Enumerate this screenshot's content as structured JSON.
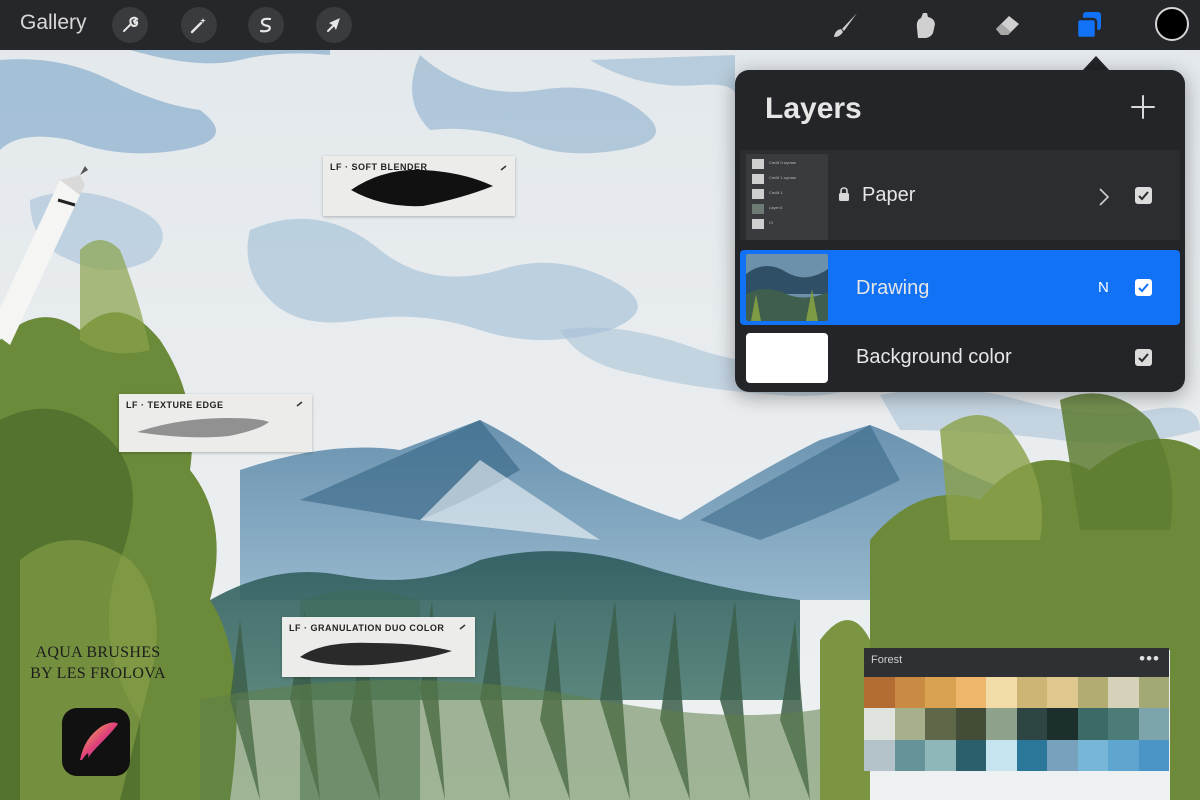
{
  "toolbar": {
    "gallery_label": "Gallery",
    "left_tools": [
      "wrench-icon",
      "magic-wand-icon",
      "selection-icon",
      "transform-arrow-icon"
    ],
    "right_tools": [
      "brush-icon",
      "smudge-icon",
      "eraser-icon",
      "layers-icon"
    ],
    "active_tool": "layers-icon",
    "current_color": "#000000"
  },
  "layers_panel": {
    "title": "Layers",
    "add_symbol": "+",
    "rows": [
      {
        "name": "Paper",
        "locked": true,
        "group": true,
        "visible": true
      },
      {
        "name": "Drawing",
        "blend_mode": "N",
        "selected": true,
        "visible": true
      },
      {
        "name": "Background color",
        "visible": true
      }
    ],
    "paper_group_layers": [
      "Cmöll 0 ыуннм",
      "Cmöll 1 ыуннм",
      "Cmöll 1",
      "Layer 6",
      "СІ"
    ]
  },
  "brushes": [
    {
      "label": "LF · SOFT BLENDER"
    },
    {
      "label": "LF · TEXTURE EDGE"
    },
    {
      "label": "LF · GRANULATION DUO COLOR"
    }
  ],
  "watermark": {
    "line1": "AQUA BRUSHES",
    "line2": "BY LES FROLOVA"
  },
  "palette": {
    "name": "Forest",
    "menu_symbol": "•••",
    "rows": [
      [
        "#b36c32",
        "#c98a44",
        "#d9a250",
        "#edb66a",
        "#f1dca8",
        "#cdb576",
        "#dfc88e",
        "#b3ac72",
        "#d6d2ba",
        "#a3a874"
      ],
      [
        "#dfe3dd",
        "#a6b08d",
        "#5e6849",
        "#424c36",
        "#8ea28b",
        "#2d4644",
        "#1d2f2c",
        "#3c6a66",
        "#4d7b78",
        "#7da4ab"
      ],
      [
        "#b4c3c9",
        "#649399",
        "#8fb7ba",
        "#2b5f6c",
        "#c6e4ef",
        "#2a779a",
        "#77a1bc",
        "#78b6d7",
        "#5ea6cf",
        "#4b95c6"
      ]
    ]
  },
  "colors": {
    "toolbar": "#26272a",
    "accent": "#1172f5",
    "panel": "#242529"
  }
}
